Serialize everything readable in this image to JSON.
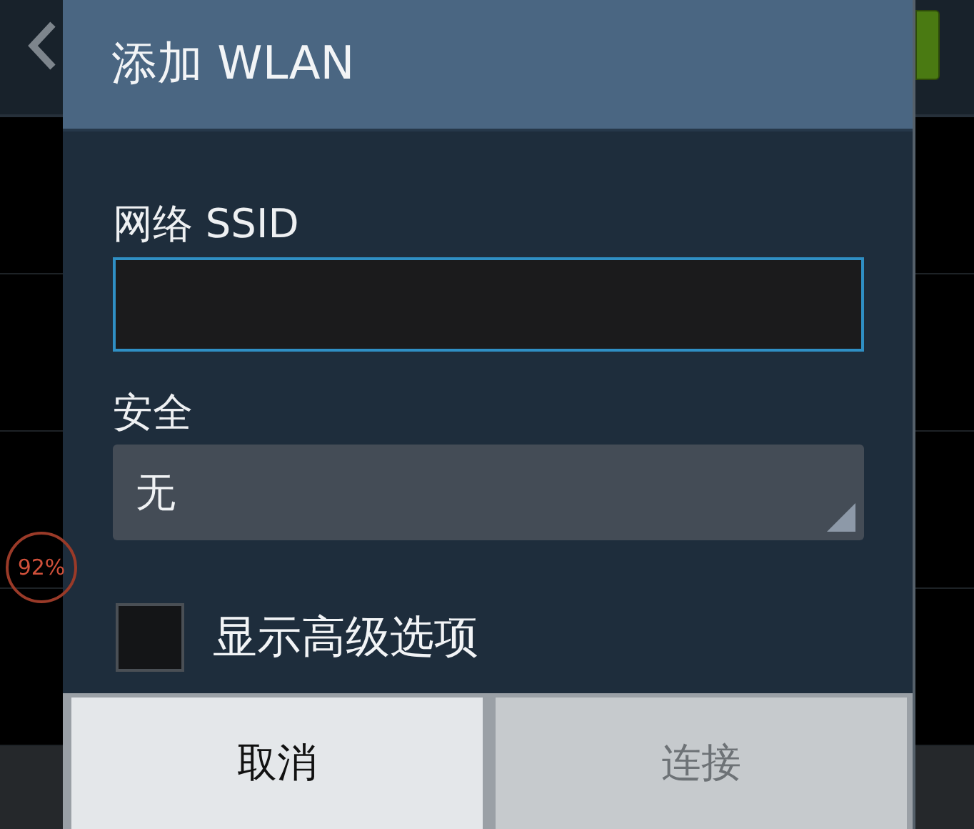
{
  "background": {
    "badge": "92%"
  },
  "dialog": {
    "title": "添加 WLAN",
    "ssid": {
      "label": "网络 SSID",
      "focused": true
    },
    "security": {
      "label": "安全",
      "value": "无"
    },
    "advanced": {
      "label": "显示高级选项",
      "checked": false
    },
    "buttons": [
      {
        "label": "取消",
        "disabled": false
      },
      {
        "label": "连接",
        "disabled": true
      }
    ]
  }
}
